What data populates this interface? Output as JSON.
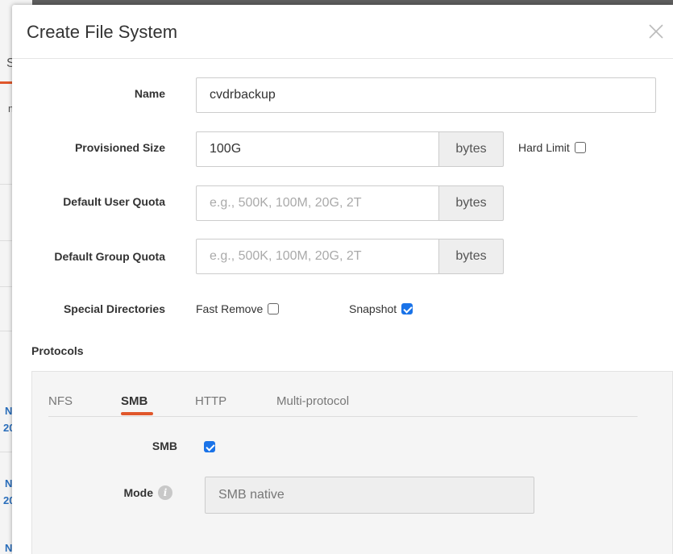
{
  "background": {
    "fragments": [
      "S",
      "m",
      "N",
      "20",
      "N",
      "20",
      "N"
    ]
  },
  "dialog": {
    "title": "Create File System",
    "close_icon": "close-icon"
  },
  "form": {
    "name": {
      "label": "Name",
      "value": "cvdrbackup"
    },
    "provisioned_size": {
      "label": "Provisioned Size",
      "value": "100G",
      "unit": "bytes",
      "hard_limit_label": "Hard Limit",
      "hard_limit_checked": false
    },
    "default_user_quota": {
      "label": "Default User Quota",
      "value": "",
      "placeholder": "e.g., 500K, 100M, 20G, 2T",
      "unit": "bytes"
    },
    "default_group_quota": {
      "label": "Default Group Quota",
      "value": "",
      "placeholder": "e.g., 500K, 100M, 20G, 2T",
      "unit": "bytes"
    },
    "special_directories": {
      "label": "Special Directories",
      "fast_remove_label": "Fast Remove",
      "fast_remove_checked": false,
      "snapshot_label": "Snapshot",
      "snapshot_checked": true
    }
  },
  "protocols": {
    "title": "Protocols",
    "tabs": [
      {
        "label": "NFS",
        "active": false
      },
      {
        "label": "SMB",
        "active": true
      },
      {
        "label": "HTTP",
        "active": false
      },
      {
        "label": "Multi-protocol",
        "active": false
      }
    ],
    "smb": {
      "enable_label": "SMB",
      "enabled": true,
      "mode_label": "Mode",
      "mode_info_icon": "info-icon",
      "mode_value": "SMB native"
    }
  },
  "colors": {
    "accent": "#e0572b",
    "checkbox_checked": "#1a73e8"
  }
}
